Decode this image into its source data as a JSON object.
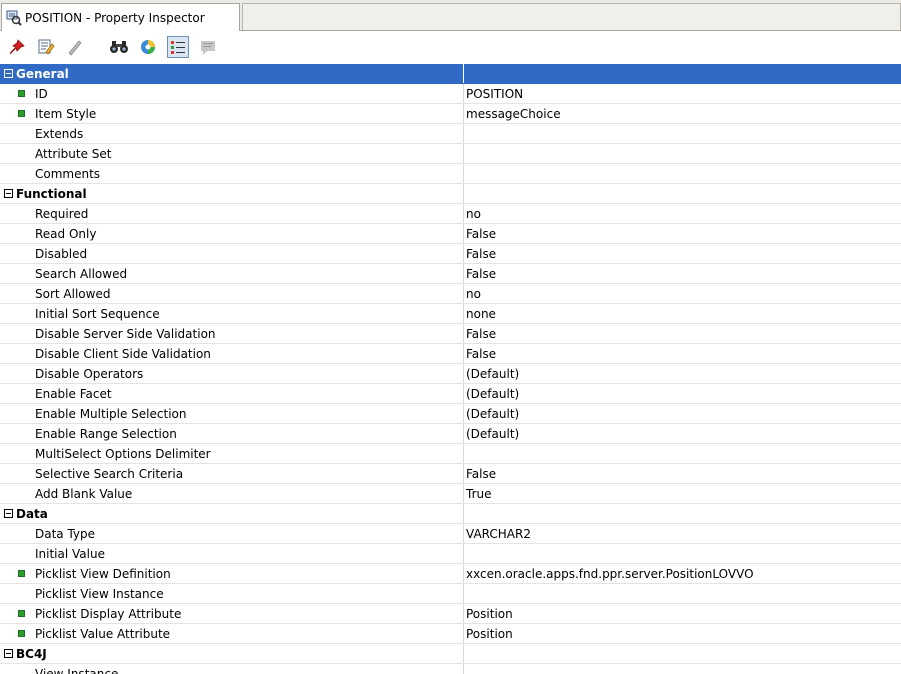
{
  "tab": {
    "title": "POSITION - Property Inspector",
    "icon": "property-inspector-icon"
  },
  "toolbar": {
    "buttons": [
      {
        "name": "pin-button",
        "icon": "pushpin-icon"
      },
      {
        "name": "edit-button",
        "icon": "edit-document-icon"
      },
      {
        "name": "pencil-button",
        "icon": "pencil-icon"
      },
      {
        "name": "find-button",
        "icon": "binoculars-icon"
      },
      {
        "name": "refresh-button",
        "icon": "color-wheel-icon"
      },
      {
        "name": "categorized-view-button",
        "icon": "categorized-list-icon",
        "pressed": true
      },
      {
        "name": "description-button",
        "icon": "description-icon"
      }
    ]
  },
  "sections": [
    {
      "name": "General",
      "selected": true,
      "rows": [
        {
          "label": "ID",
          "value": "POSITION",
          "marker": true
        },
        {
          "label": "Item Style",
          "value": "messageChoice",
          "marker": true
        },
        {
          "label": "Extends",
          "value": ""
        },
        {
          "label": "Attribute Set",
          "value": ""
        },
        {
          "label": "Comments",
          "value": ""
        }
      ]
    },
    {
      "name": "Functional",
      "rows": [
        {
          "label": "Required",
          "value": "no"
        },
        {
          "label": "Read Only",
          "value": "False"
        },
        {
          "label": "Disabled",
          "value": "False"
        },
        {
          "label": "Search Allowed",
          "value": "False"
        },
        {
          "label": "Sort Allowed",
          "value": "no"
        },
        {
          "label": "Initial Sort Sequence",
          "value": "none"
        },
        {
          "label": "Disable Server Side Validation",
          "value": "False"
        },
        {
          "label": "Disable Client Side Validation",
          "value": "False"
        },
        {
          "label": "Disable Operators",
          "value": "(Default)"
        },
        {
          "label": "Enable Facet",
          "value": "(Default)"
        },
        {
          "label": "Enable Multiple Selection",
          "value": "(Default)"
        },
        {
          "label": "Enable Range Selection",
          "value": "(Default)"
        },
        {
          "label": "MultiSelect Options Delimiter",
          "value": ""
        },
        {
          "label": "Selective Search Criteria",
          "value": "False"
        },
        {
          "label": "Add Blank Value",
          "value": "True"
        }
      ]
    },
    {
      "name": "Data",
      "rows": [
        {
          "label": "Data Type",
          "value": "VARCHAR2"
        },
        {
          "label": "Initial Value",
          "value": ""
        },
        {
          "label": "Picklist View Definition",
          "value": "xxcen.oracle.apps.fnd.ppr.server.PositionLOVVO",
          "marker": true
        },
        {
          "label": "Picklist View Instance",
          "value": ""
        },
        {
          "label": "Picklist Display Attribute",
          "value": "Position",
          "marker": true
        },
        {
          "label": "Picklist Value Attribute",
          "value": "Position",
          "marker": true
        }
      ]
    },
    {
      "name": "BC4J",
      "rows": [
        {
          "label": "View Instance",
          "value": ""
        }
      ]
    }
  ]
}
